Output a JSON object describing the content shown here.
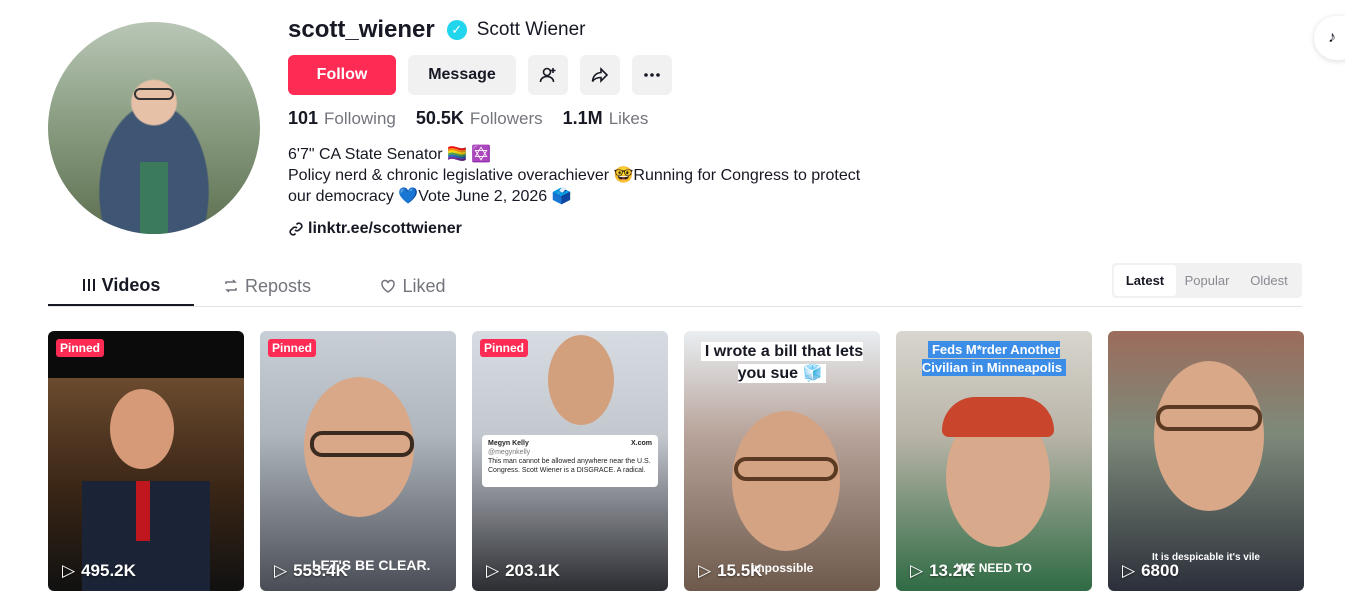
{
  "profile": {
    "username": "scott_wiener",
    "display_name": "Scott Wiener",
    "verified_mark": "✓",
    "follow_label": "Follow",
    "message_label": "Message",
    "stats": [
      {
        "value": "101",
        "label": "Following"
      },
      {
        "value": "50.5K",
        "label": "Followers"
      },
      {
        "value": "1.1M",
        "label": "Likes"
      }
    ],
    "bio": [
      "6'7\" CA State Senator 🏳️‍🌈 ✡️",
      "Policy nerd & chronic legislative overachiever 🤓Running for Congress to protect",
      "our democracy 💙Vote June 2, 2026 🗳️"
    ],
    "link": "linktr.ee/scottwiener"
  },
  "tabs": [
    {
      "label": "Videos",
      "icon": "grid-icon"
    },
    {
      "label": "Reposts",
      "icon": "repost-icon"
    },
    {
      "label": "Liked",
      "icon": "heart-icon"
    }
  ],
  "sort": [
    "Latest",
    "Popular",
    "Oldest"
  ],
  "videos": [
    {
      "pinned": "Pinned",
      "views": "495.2K",
      "caption": "",
      "overlay": ""
    },
    {
      "pinned": "Pinned",
      "views": "553.4K",
      "caption": "",
      "overlay": "LET'S BE CLEAR."
    },
    {
      "pinned": "Pinned",
      "views": "203.1K",
      "caption": "",
      "overlay": "",
      "tweet": {
        "name": "Megyn Kelly",
        "handle": "@megynkelly",
        "source": "X.com",
        "text": "This man cannot be allowed anywhere near the U.S. Congress. Scott Wiener is a DISGRACE. A radical."
      }
    },
    {
      "pinned": "",
      "views": "15.5K",
      "caption": "I wrote a bill that lets you sue 🧊",
      "overlay": "impossible"
    },
    {
      "pinned": "",
      "views": "13.2K",
      "caption": "Feds M*rder Another Civilian in Minneapolis",
      "overlay": "WE NEED TO"
    },
    {
      "pinned": "",
      "views": "6800",
      "caption": "",
      "overlay": "It is despicable it's vile"
    }
  ],
  "colors": {
    "accent": "#fe2c55",
    "verified": "#20d5ec"
  }
}
